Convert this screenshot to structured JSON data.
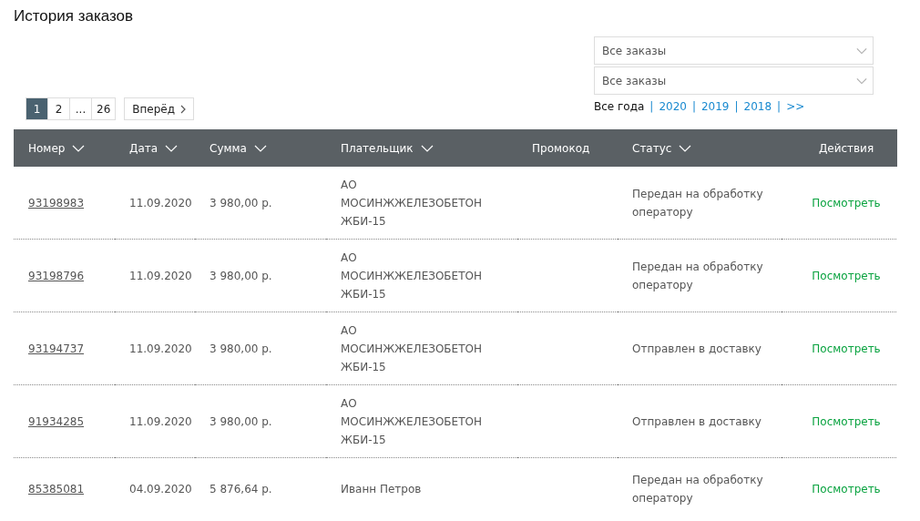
{
  "title": "История заказов",
  "filters": [
    {
      "value": "Все заказы"
    },
    {
      "value": "Все заказы"
    }
  ],
  "years_filter": {
    "separator": "|",
    "items": [
      {
        "label": "Все года",
        "selected": true
      },
      {
        "label": "2020",
        "selected": false
      },
      {
        "label": "2019",
        "selected": false
      },
      {
        "label": "2018",
        "selected": false
      },
      {
        "label": ">>",
        "selected": false
      }
    ]
  },
  "pagination": {
    "pages": [
      {
        "label": "1",
        "selected": true
      },
      {
        "label": "2",
        "selected": false
      },
      {
        "label": "...",
        "selected": false
      },
      {
        "label": "26",
        "selected": false
      }
    ],
    "next": "Вперёд"
  },
  "table": {
    "columns": [
      {
        "label": "Номер",
        "sortable": true
      },
      {
        "label": "Дата",
        "sortable": true
      },
      {
        "label": "Сумма",
        "sortable": true
      },
      {
        "label": "Плательщик",
        "sortable": true
      },
      {
        "label": "Промокод",
        "sortable": false
      },
      {
        "label": "Статус",
        "sortable": true
      },
      {
        "label": "Действия",
        "sortable": false
      }
    ],
    "rows": [
      {
        "number": "93198983",
        "date": "11.09.2020",
        "sum": "3 980,00 р.",
        "payer": [
          "АО",
          "МОСИНЖЖЕЛЕЗОБЕТОН",
          "ЖБИ-15"
        ],
        "status": [
          "Передан на обработку",
          "оператору"
        ],
        "action": "Посмотреть"
      },
      {
        "number": "93198796",
        "date": "11.09.2020",
        "sum": "3 980,00 р.",
        "payer": [
          "АО",
          "МОСИНЖЖЕЛЕЗОБЕТОН",
          "ЖБИ-15"
        ],
        "status": [
          "Передан на обработку",
          "оператору"
        ],
        "action": "Посмотреть"
      },
      {
        "number": "93194737",
        "date": "11.09.2020",
        "sum": "3 980,00 р.",
        "payer": [
          "АО",
          "МОСИНЖЖЕЛЕЗОБЕТОН",
          "ЖБИ-15"
        ],
        "status": [
          "Отправлен в доставку"
        ],
        "action": "Посмотреть"
      },
      {
        "number": "91934285",
        "date": "11.09.2020",
        "sum": "3 980,00 р.",
        "payer": [
          "АО",
          "МОСИНЖЖЕЛЕЗОБЕТОН",
          "ЖБИ-15"
        ],
        "status": [
          "Отправлен в доставку"
        ],
        "action": "Посмотреть"
      },
      {
        "number": "85385081",
        "date": "04.09.2020",
        "sum": "5 876,64 р.",
        "payer": [
          "Иванн Петров"
        ],
        "status": [
          "Передан на обработку",
          "оператору"
        ],
        "action": "Посмотреть"
      }
    ]
  }
}
